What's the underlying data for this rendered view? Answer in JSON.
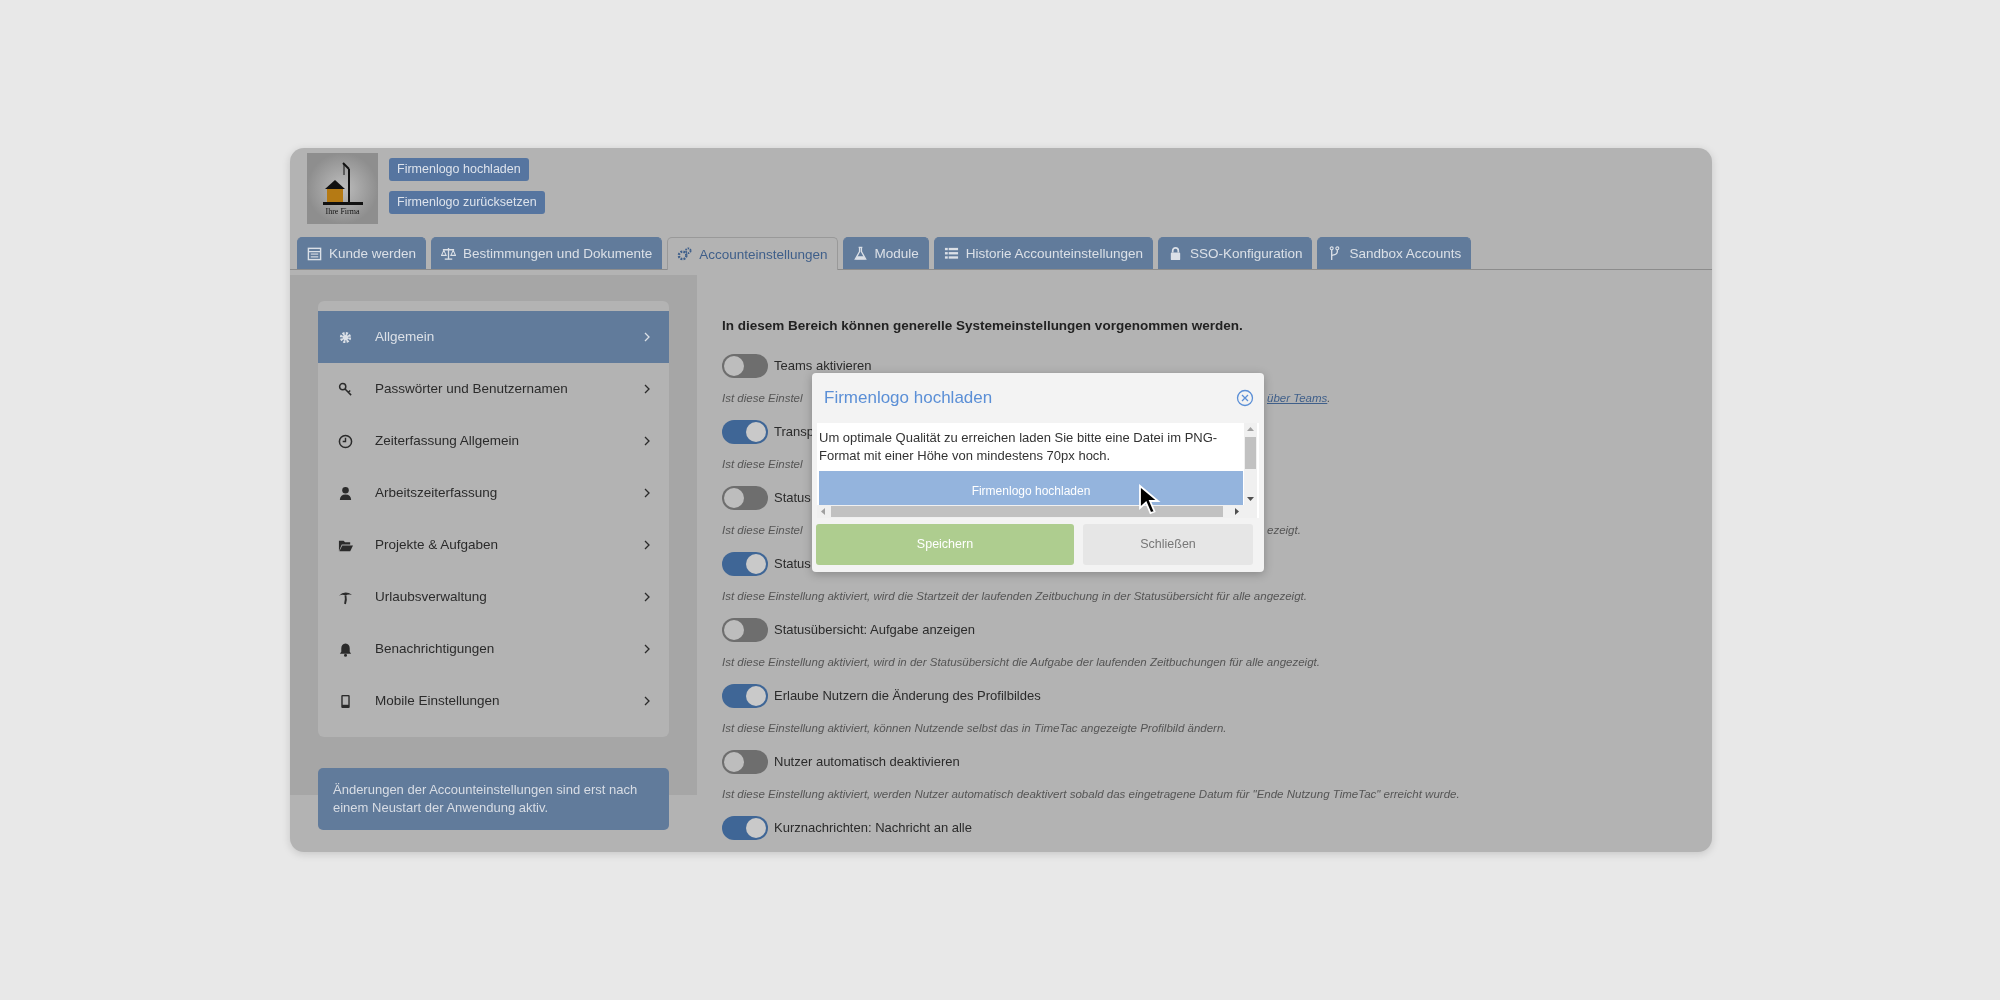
{
  "header": {
    "logo_caption": "Ihre Firma",
    "buttons": [
      "Firmenlogo hochladen",
      "Firmenlogo zurücksetzen"
    ]
  },
  "tabs": [
    {
      "label": "Kunde werden",
      "selected": false
    },
    {
      "label": "Bestimmungen und Dokumente",
      "selected": false
    },
    {
      "label": "Accounteinstellungen",
      "selected": true
    },
    {
      "label": "Module",
      "selected": false
    },
    {
      "label": "Historie Accounteinstellungen",
      "selected": false
    },
    {
      "label": "SSO-Konfiguration",
      "selected": false
    },
    {
      "label": "Sandbox Accounts",
      "selected": false
    }
  ],
  "sidebar": {
    "items": [
      {
        "label": "Allgemein",
        "selected": true
      },
      {
        "label": "Passwörter und Benutzernamen",
        "selected": false
      },
      {
        "label": "Zeiterfassung Allgemein",
        "selected": false
      },
      {
        "label": "Arbeitszeiterfassung",
        "selected": false
      },
      {
        "label": "Projekte & Aufgaben",
        "selected": false
      },
      {
        "label": "Urlaubsverwaltung",
        "selected": false
      },
      {
        "label": "Benachrichtigungen",
        "selected": false
      },
      {
        "label": "Mobile Einstellungen",
        "selected": false
      }
    ],
    "notice": "Änderungen der Accounteinstellungen sind erst nach einem Neustart der Anwendung aktiv."
  },
  "content": {
    "intro": "In diesem Bereich können generelle Systemeinstellungen vorgenommen werden.",
    "settings": [
      {
        "label": "Teams aktivieren",
        "on": false,
        "description": "Ist diese Einstel",
        "tail_link": "über Teams",
        "tail": "."
      },
      {
        "label": "Transp",
        "on": true,
        "description": "Ist diese Einstel"
      },
      {
        "label": "Status",
        "on": false,
        "description": "Ist diese Einstel",
        "tail": "ezeigt."
      },
      {
        "label": "Status",
        "on": true,
        "description": "Ist diese Einstellung aktiviert, wird die Startzeit der laufenden Zeitbuchung in der Statusübersicht für alle angezeigt."
      },
      {
        "label": "Statusübersicht: Aufgabe anzeigen",
        "on": false,
        "description": "Ist diese Einstellung aktiviert, wird in der Statusübersicht die Aufgabe der laufenden Zeitbuchungen für alle angezeigt."
      },
      {
        "label": "Erlaube Nutzern die Änderung des Profilbildes",
        "on": true,
        "description": "Ist diese Einstellung aktiviert, können Nutzende selbst das in TimeTac angezeigte Profilbild ändern."
      },
      {
        "label": "Nutzer automatisch deaktivieren",
        "on": false,
        "description": "Ist diese Einstellung aktiviert, werden Nutzer automatisch deaktivert sobald das eingetragene Datum für \"Ende Nutzung TimeTac\" erreicht wurde."
      },
      {
        "label": "Kurznachrichten: Nachricht an alle",
        "on": true
      }
    ]
  },
  "dialog": {
    "title": "Firmenlogo hochladen",
    "message": "Um optimale Qualität zu erreichen laden Sie bitte eine Datei im PNG-Format mit einer Höhe von mindestens 70px hoch.",
    "upload_button": "Firmenlogo hochladen",
    "buttons": [
      {
        "label": "Speichern",
        "kind": "primary"
      },
      {
        "label": "Schließen",
        "kind": "secondary"
      }
    ]
  }
}
